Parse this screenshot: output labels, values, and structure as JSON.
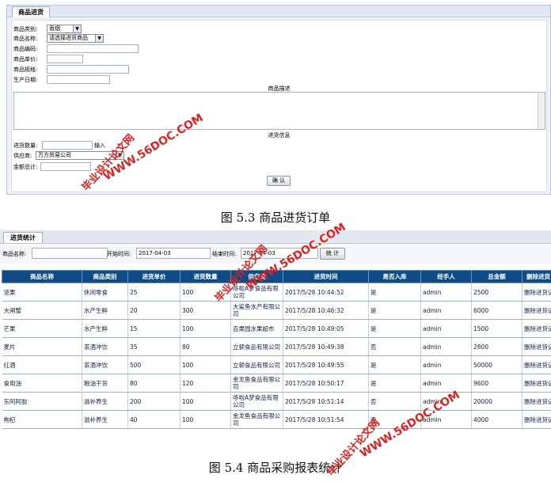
{
  "entry_form": {
    "tab_label": "商品进货",
    "fields": {
      "category_label": "商品类别:",
      "category_value": "香烟",
      "name_label": "商品名称:",
      "name_value": "请选择进货商品",
      "code_label": "商品编码:",
      "price_label": "商品单价:",
      "spec_label": "商品规格:",
      "date_label": "生产日期:",
      "description_label": "商品描述",
      "purchase_info_label": "进货信息",
      "quantity_label": "进货数量:",
      "quantity_hint": "输入",
      "supplier_label": "供应商:",
      "supplier_value": "万方贸易公司",
      "total_label": "金额总计:"
    },
    "confirm_label": "确 认"
  },
  "caption1": "图 5.3 商品进货订单",
  "stats": {
    "tab_label": "进货统计",
    "search": {
      "name_label": "商品名称:",
      "start_label": "开始时间:",
      "start_value": "2017-04-03",
      "end_label": "结束时间:",
      "end_value": "2017-04-03",
      "button_label": "统 计"
    },
    "columns": [
      "商品名称",
      "商品类别",
      "进货单价",
      "进货数量",
      "供应商",
      "进货时间",
      "是否入库",
      "经手人",
      "总金额",
      "删除进货"
    ],
    "rows": [
      [
        "坚果",
        "休闲零食",
        "25",
        "100",
        "哆啦A梦食品有限公司",
        "2017/5/28 10:44:52",
        "是",
        "admin",
        "2500",
        "删除进货记"
      ],
      [
        "大闸蟹",
        "水产生鲜",
        "20",
        "300",
        "大鲨鱼水产有限公司",
        "2017/5/28 10:46:32",
        "是",
        "admin",
        "6000",
        "删除进货记"
      ],
      [
        "芒果",
        "水产生鲜",
        "15",
        "100",
        "百果园水果超市",
        "2017/5/28 10:49:05",
        "是",
        "admin",
        "1500",
        "删除进货记"
      ],
      [
        "麦片",
        "茶酒冲饮",
        "35",
        "80",
        "立顿食品有限公司",
        "2017/5/28 10:49:38",
        "否",
        "admin",
        "2800",
        "删除进货记"
      ],
      [
        "红酒",
        "茶酒冲饮",
        "500",
        "100",
        "立顿食品有限公司",
        "2017/5/28 10:49:55",
        "是",
        "admin",
        "50000",
        "删除进货记"
      ],
      [
        "食用油",
        "粮油干货",
        "80",
        "120",
        "金龙鱼食品有限公司",
        "2017/5/28 10:50:17",
        "是",
        "admin",
        "9600",
        "删除进货记"
      ],
      [
        "东阿阿胶",
        "滋补养生",
        "200",
        "100",
        "哆啦A梦食品有限公司",
        "2017/5/28 10:51:14",
        "否",
        "admin",
        "20000",
        "删除进货记"
      ],
      [
        "枸杞",
        "滋补养生",
        "40",
        "100",
        "金龙鱼食品有限公司",
        "2017/5/28 10:51:54",
        "否",
        "admin",
        "4000",
        "删除进货记"
      ]
    ]
  },
  "caption2": "图 5.4 商品采购报表统计",
  "watermark": {
    "url": "WWW.56DOC.COM",
    "cn": "毕业设计论文网"
  }
}
